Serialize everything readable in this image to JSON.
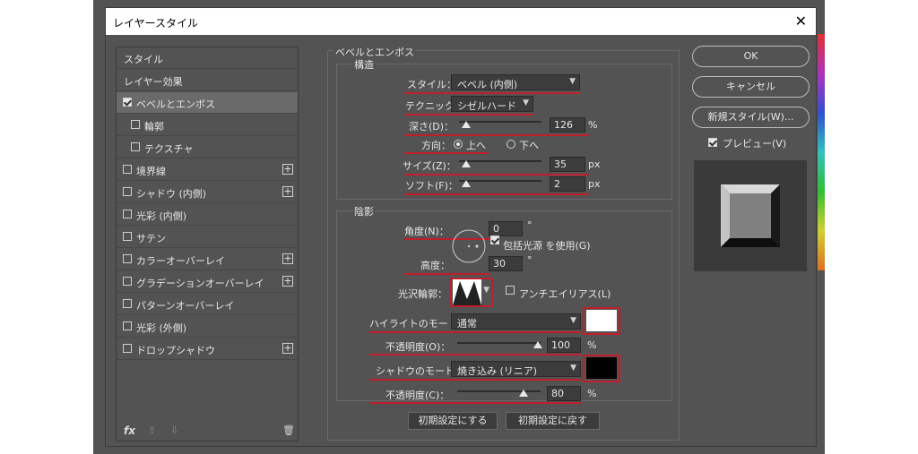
{
  "window": {
    "title": "レイヤースタイル",
    "close_glyph": "✕"
  },
  "left_panel": {
    "items": [
      {
        "label": "スタイル",
        "checkbox": false,
        "checked": false,
        "plus": false
      },
      {
        "label": "レイヤー効果",
        "checkbox": false,
        "checked": false,
        "plus": false
      },
      {
        "label": "ベベルとエンボス",
        "checkbox": true,
        "checked": true,
        "plus": false,
        "selected": true
      },
      {
        "label": "輪郭",
        "checkbox": true,
        "checked": false,
        "plus": false,
        "sub": true
      },
      {
        "label": "テクスチャ",
        "checkbox": true,
        "checked": false,
        "plus": false,
        "sub": true
      },
      {
        "label": "境界線",
        "checkbox": true,
        "checked": false,
        "plus": true
      },
      {
        "label": "シャドウ (内側)",
        "checkbox": true,
        "checked": false,
        "plus": true
      },
      {
        "label": "光彩 (内側)",
        "checkbox": true,
        "checked": false,
        "plus": false
      },
      {
        "label": "サテン",
        "checkbox": true,
        "checked": false,
        "plus": false
      },
      {
        "label": "カラーオーバーレイ",
        "checkbox": true,
        "checked": false,
        "plus": true
      },
      {
        "label": "グラデーションオーバーレイ",
        "checkbox": true,
        "checked": false,
        "plus": true
      },
      {
        "label": "パターンオーバーレイ",
        "checkbox": true,
        "checked": false,
        "plus": false
      },
      {
        "label": "光彩 (外側)",
        "checkbox": true,
        "checked": false,
        "plus": false
      },
      {
        "label": "ドロップシャドウ",
        "checkbox": true,
        "checked": false,
        "plus": true
      }
    ],
    "bottom": {
      "fx": "fx",
      "up": "⇧",
      "down": "⇩",
      "trash": "🗑"
    }
  },
  "bevel": {
    "section_title": "ベベルとエンボス",
    "structure_title": "構造",
    "style_label": "スタイル：",
    "style_value": "ベベル (内側)",
    "technique_label": "テクニック：",
    "technique_value": "シゼルハード",
    "depth_label": "深さ(D)：",
    "depth_value": "126",
    "depth_unit": "%",
    "direction_label": "方向：",
    "direction_up": "上へ",
    "direction_down": "下へ",
    "size_label": "サイズ(Z)：",
    "size_value": "35",
    "size_unit": "px",
    "soften_label": "ソフト(F)：",
    "soften_value": "2",
    "soften_unit": "px"
  },
  "shading": {
    "title": "陰影",
    "angle_label": "角度(N)：",
    "angle_value": "0",
    "degree": "°",
    "global_light_label": "包括光源 を使用(G)",
    "altitude_label": "高度：",
    "altitude_value": "30",
    "gloss_label": "光沢輪郭：",
    "antialias_label": "アンチエイリアス(L)",
    "highlight_mode_label": "ハイライトのモード：",
    "highlight_mode_value": "通常",
    "highlight_opacity_label": "不透明度(O)：",
    "highlight_opacity_value": "100",
    "shadow_mode_label": "シャドウのモード：",
    "shadow_mode_value": "焼き込み (リニア)",
    "shadow_opacity_label": "不透明度(C)：",
    "shadow_opacity_value": "80",
    "percent": "%",
    "highlight_color": "#ffffff",
    "shadow_color": "#000000"
  },
  "defaults": {
    "make_default": "初期設定にする",
    "reset_default": "初期設定に戻す"
  },
  "right": {
    "ok": "OK",
    "cancel": "キャンセル",
    "new_style": "新規スタイル(W)...",
    "preview_label": "プレビュー(V)"
  },
  "colors": {
    "accent_red": "#c01e2a",
    "panel_bg": "#535353"
  }
}
